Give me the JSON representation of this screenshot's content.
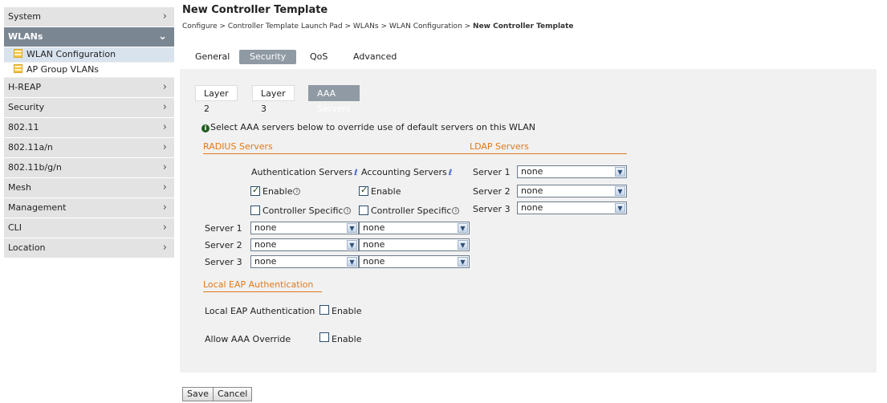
{
  "sidebar": {
    "items": [
      {
        "label": "System"
      },
      {
        "label": "WLANs"
      },
      {
        "label": "H-REAP"
      },
      {
        "label": "Security"
      },
      {
        "label": "802.11"
      },
      {
        "label": "802.11a/n"
      },
      {
        "label": "802.11b/g/n"
      },
      {
        "label": "Mesh"
      },
      {
        "label": "Management"
      },
      {
        "label": "CLI"
      },
      {
        "label": "Location"
      }
    ],
    "wlans_sub": [
      {
        "label": "WLAN Configuration"
      },
      {
        "label": "AP Group VLANs"
      }
    ]
  },
  "header": {
    "title": "New Controller Template",
    "breadcrumb_prefix": "Configure > Controller Template Launch Pad > WLANs > WLAN Configuration > ",
    "breadcrumb_current": "New Controller Template"
  },
  "tabs": [
    "General",
    "Security",
    "QoS",
    "Advanced"
  ],
  "subtabs": [
    "Layer 2",
    "Layer 3",
    "AAA Servers"
  ],
  "info": "Select AAA servers below to override use of default servers on this WLAN",
  "radius": {
    "heading": "RADIUS Servers",
    "auth_label": "Authentication Servers",
    "acct_label": "Accounting Servers",
    "enable_label": "Enable",
    "controller_specific_label": "Controller Specific",
    "servers": [
      {
        "label": "Server 1",
        "auth": "none",
        "acct": "none"
      },
      {
        "label": "Server 2",
        "auth": "none",
        "acct": "none"
      },
      {
        "label": "Server 3",
        "auth": "none",
        "acct": "none"
      }
    ]
  },
  "ldap": {
    "heading": "LDAP Servers",
    "servers": [
      {
        "label": "Server 1",
        "value": "none"
      },
      {
        "label": "Server 2",
        "value": "none"
      },
      {
        "label": "Server 3",
        "value": "none"
      }
    ]
  },
  "local_eap": {
    "heading": "Local EAP Authentication",
    "row_label": "Local EAP Authentication",
    "enable_label": "Enable"
  },
  "aaa_override": {
    "row_label": "Allow AAA Override",
    "enable_label": "Enable"
  },
  "buttons": {
    "save": "Save",
    "cancel": "Cancel"
  }
}
